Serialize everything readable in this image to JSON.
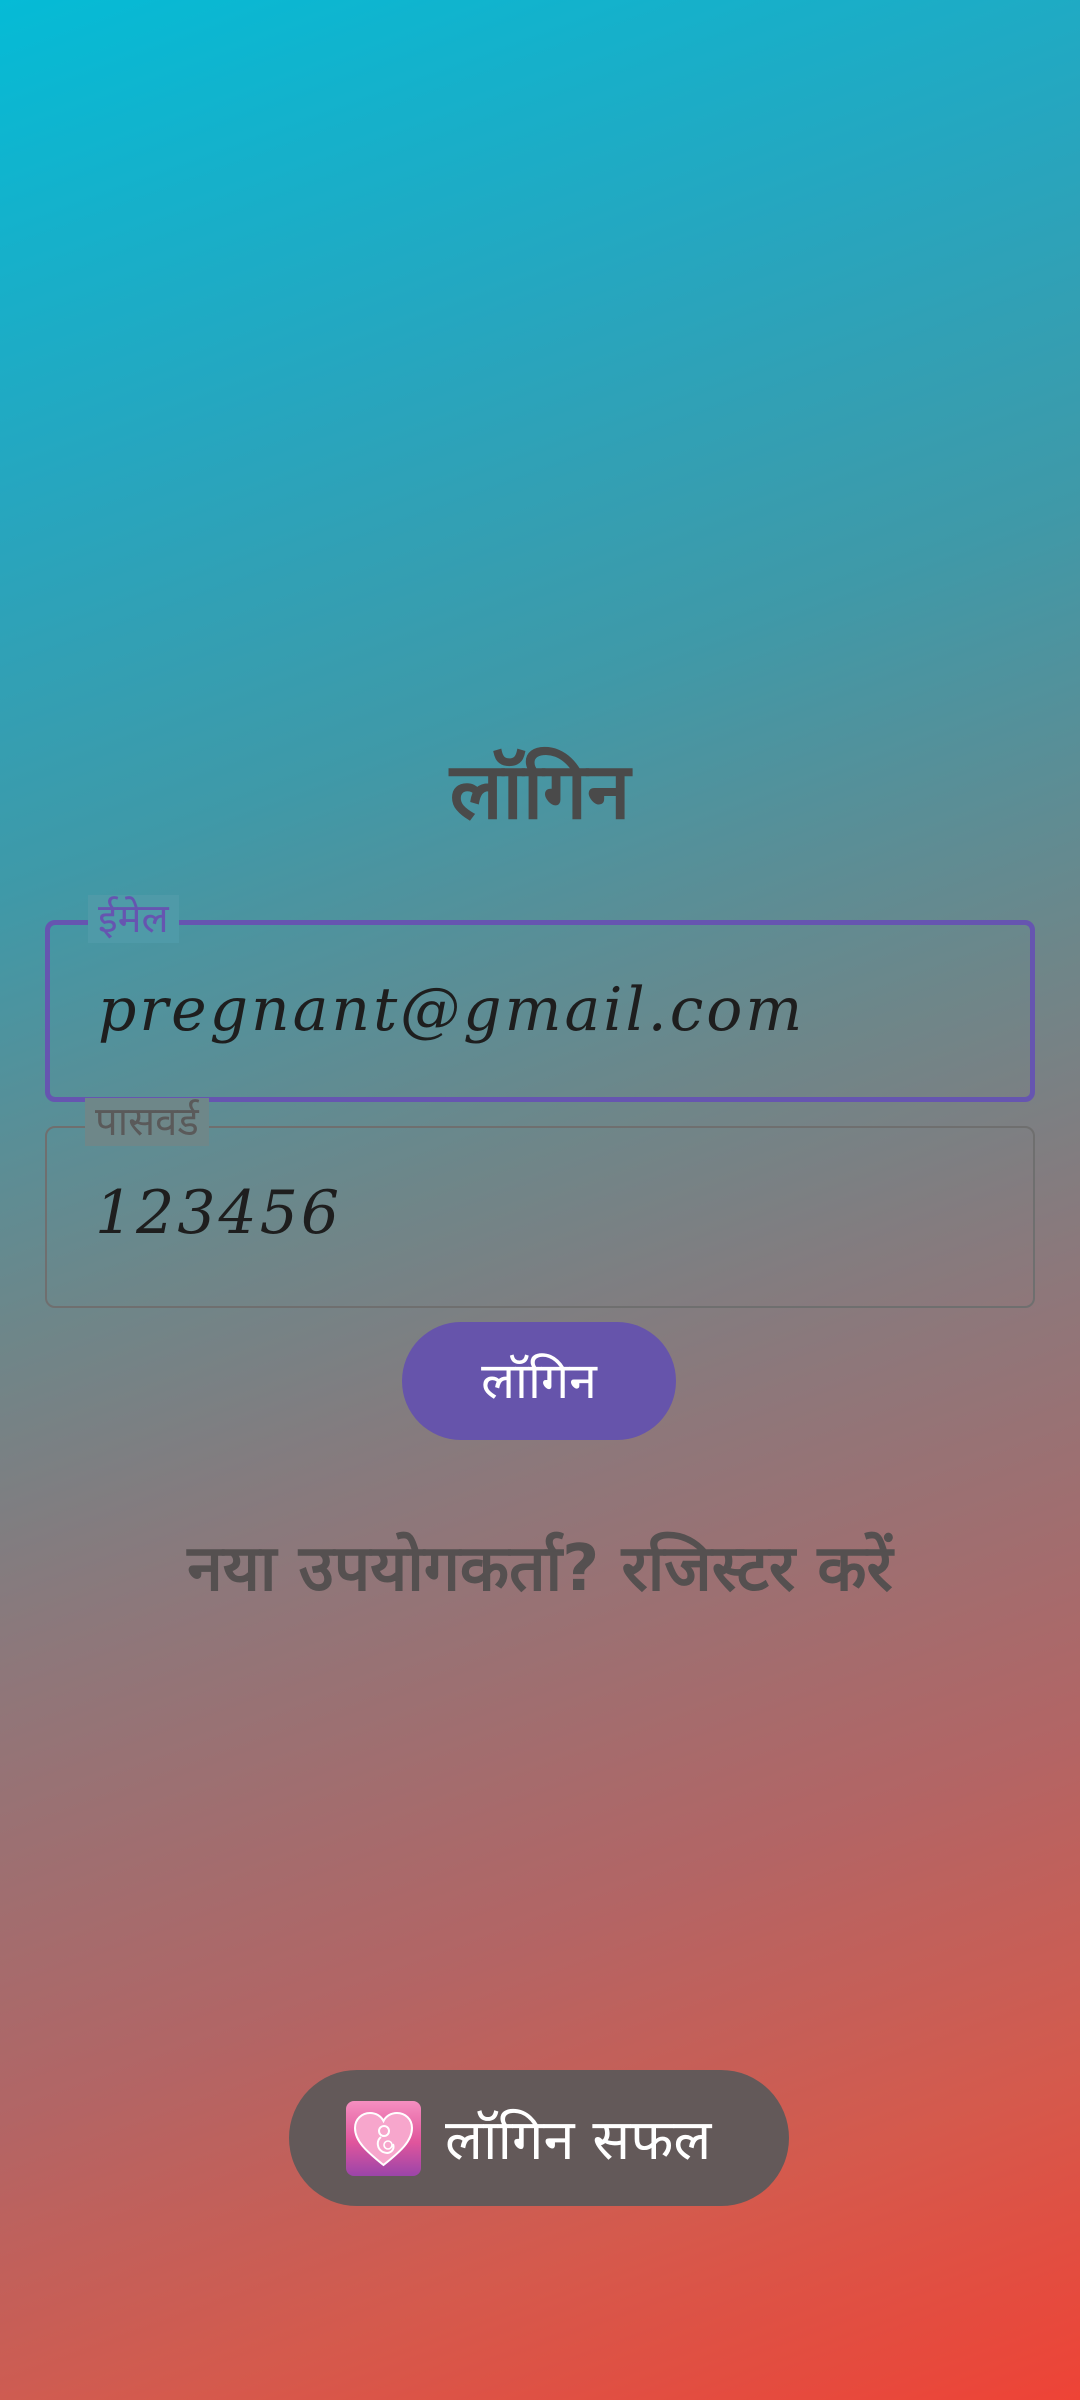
{
  "title": "लॉगिन",
  "email": {
    "label": "ईमेल",
    "value": "pregnant@gmail.com"
  },
  "password": {
    "label": "पासवर्ड",
    "value": "123456"
  },
  "login_button": "लॉगिन",
  "register_link": "नया उपयोगकर्ता? रजिस्टर करें",
  "toast": {
    "icon": "pregnancy-heart-icon",
    "text": "लॉगिन सफल"
  },
  "colors": {
    "accent": "#6654ab",
    "gradient_top": "#05bbd6",
    "gradient_bottom": "#ee4336",
    "toast_bg": "#635959"
  }
}
